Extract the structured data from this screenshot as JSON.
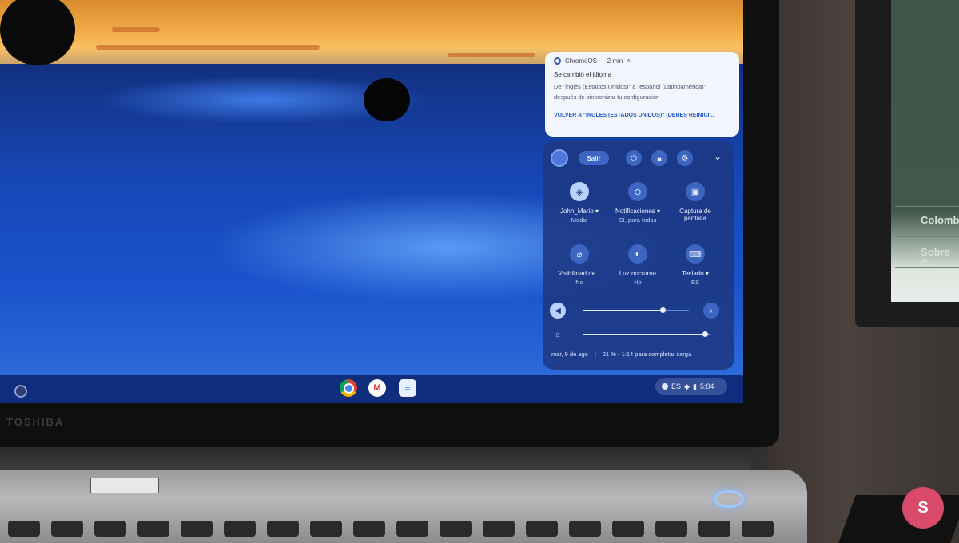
{
  "laptop_brand": "TOSHIBA",
  "external_screen": {
    "items": [
      "Colomb",
      "Sobre G"
    ]
  },
  "notification": {
    "app": "ChromeOS",
    "time": "2 min",
    "title": "Se cambió el idioma",
    "body_line1": "De \"inglés (Estados Unidos)\" a \"español (Latinoamérica)\"",
    "body_line2": "después de sincronizar tu configuración",
    "action": "VOLVER A \"INGLÉS (ESTADOS UNIDOS)\" (DEBES REINICI..."
  },
  "quick_settings": {
    "signout_label": "Salir",
    "tiles": [
      {
        "label": "John_Mario ▾",
        "sub": "Media",
        "icon": "wifi-icon",
        "on": true
      },
      {
        "label": "Notificaciones ▾",
        "sub": "Sí, para todas",
        "icon": "minus-circle-icon",
        "on": false
      },
      {
        "label": "Captura de pantalla",
        "sub": "",
        "icon": "screen-capture-icon",
        "on": false
      },
      {
        "label": "Visibilidad de...",
        "sub": "No",
        "icon": "eye-off-icon",
        "on": false
      },
      {
        "label": "Luz nocturna",
        "sub": "No",
        "icon": "night-light-icon",
        "on": false
      },
      {
        "label": "Teclado ▾",
        "sub": "ES",
        "icon": "keyboard-icon",
        "on": false
      }
    ],
    "volume_level": 0.75,
    "brightness_level": 0.95,
    "date": "mar, 9 de ago",
    "battery_text": "21 % - 1:14 para completar carga"
  },
  "tray": {
    "ime": "ES",
    "time": "5:04"
  },
  "watermark": "S"
}
